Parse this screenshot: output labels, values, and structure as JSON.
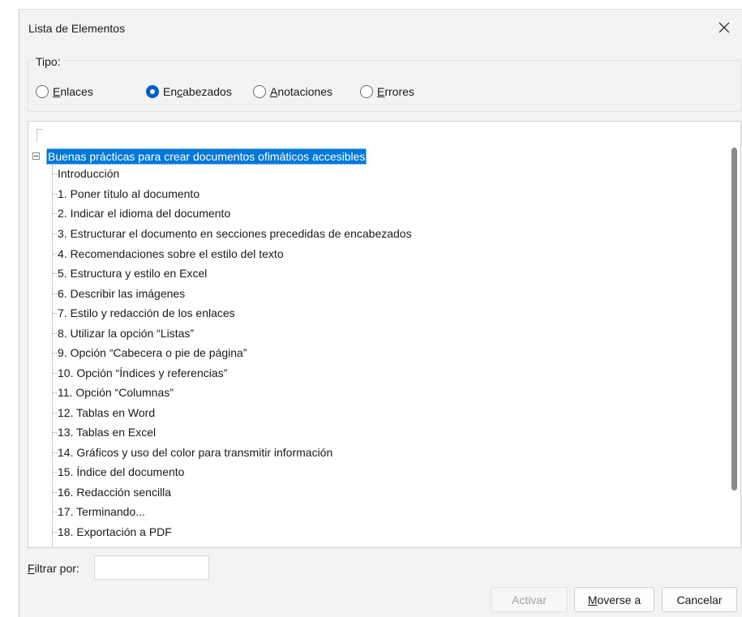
{
  "window": {
    "title": "Lista de Elementos"
  },
  "tipo": {
    "label": "Tipo:",
    "options": [
      {
        "pre": "",
        "key": "E",
        "post": "nlaces",
        "checked": false
      },
      {
        "pre": "En",
        "key": "c",
        "post": "abezados",
        "checked": true
      },
      {
        "pre": "",
        "key": "A",
        "post": "notaciones",
        "checked": false
      },
      {
        "pre": "",
        "key": "E",
        "post": "rrores",
        "checked": false
      }
    ]
  },
  "tree": {
    "root": "Buenas prácticas para crear documentos ofimáticos accesibles",
    "items": [
      "Introducción",
      "1. Poner título al documento",
      "2. Indicar el idioma del documento",
      "3. Estructurar el documento en secciones precedidas de encabezados",
      "4. Recomendaciones sobre el estilo del texto",
      "5. Estructura y estilo en Excel",
      "6. Describir las imágenes",
      "7. Estilo y redacción de los enlaces",
      "8. Utilizar la opción “Listas”",
      "9. Opción “Cabecera o pie de página”",
      "10. Opción “Índices y referencias”",
      "11. Opción “Columnas”",
      "12. Tablas en Word",
      "13. Tablas en Excel",
      "14. Gráficos y uso del color para transmitir información",
      "15. Índice del documento",
      "16. Redacción sencilla",
      "17. Terminando...",
      "18. Exportación a PDF"
    ]
  },
  "filter": {
    "key": "F",
    "rest": "iltrar por:",
    "value": ""
  },
  "buttons": {
    "activar": "Activar",
    "moverse_key": "M",
    "moverse_rest": "overse a",
    "cancelar": "Cancelar"
  },
  "colors": {
    "selection": "#0078d7",
    "radio_checked": "#0060c0"
  }
}
